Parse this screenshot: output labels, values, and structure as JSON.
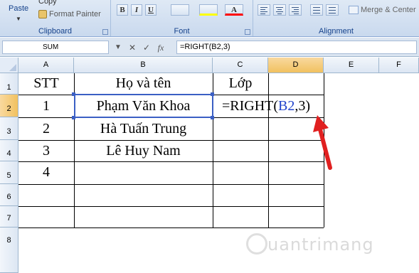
{
  "ribbon": {
    "clipboard": {
      "label": "Clipboard",
      "paste_label": "Paste",
      "copy_label": "Copy",
      "format_painter_label": "Format Painter"
    },
    "font": {
      "label": "Font",
      "bold": "B",
      "italic": "I",
      "underline": "U"
    },
    "alignment": {
      "label": "Alignment",
      "merge_label": "Merge & Center"
    }
  },
  "formula_bar": {
    "name_box": "SUM",
    "cancel_icon": "✕",
    "enter_icon": "✓",
    "fx_label": "fx",
    "formula": "=RIGHT(B2,3)"
  },
  "sheet": {
    "columns": [
      "A",
      "B",
      "C",
      "D",
      "E",
      "F"
    ],
    "rows": [
      "1",
      "2",
      "3",
      "4",
      "5",
      "6",
      "7",
      "8"
    ],
    "cells": {
      "A1": "STT",
      "B1": "Họ và tên",
      "C1": "Lớp",
      "A2": "1",
      "B2": "Phạm Văn Khoa",
      "A3": "2",
      "B3": "Hà Tuấn Trung",
      "A4": "3",
      "B4": "Lê Huy Nam",
      "A5": "4"
    },
    "editing_cell": {
      "prefix": "=RIGHT(",
      "ref": "B2",
      "suffix": ",3)"
    }
  },
  "colors": {
    "selected_header": "#f1c15f",
    "reference_blue": "#2244cc",
    "arrow_red": "#e02020"
  },
  "watermark": "uantrimang"
}
